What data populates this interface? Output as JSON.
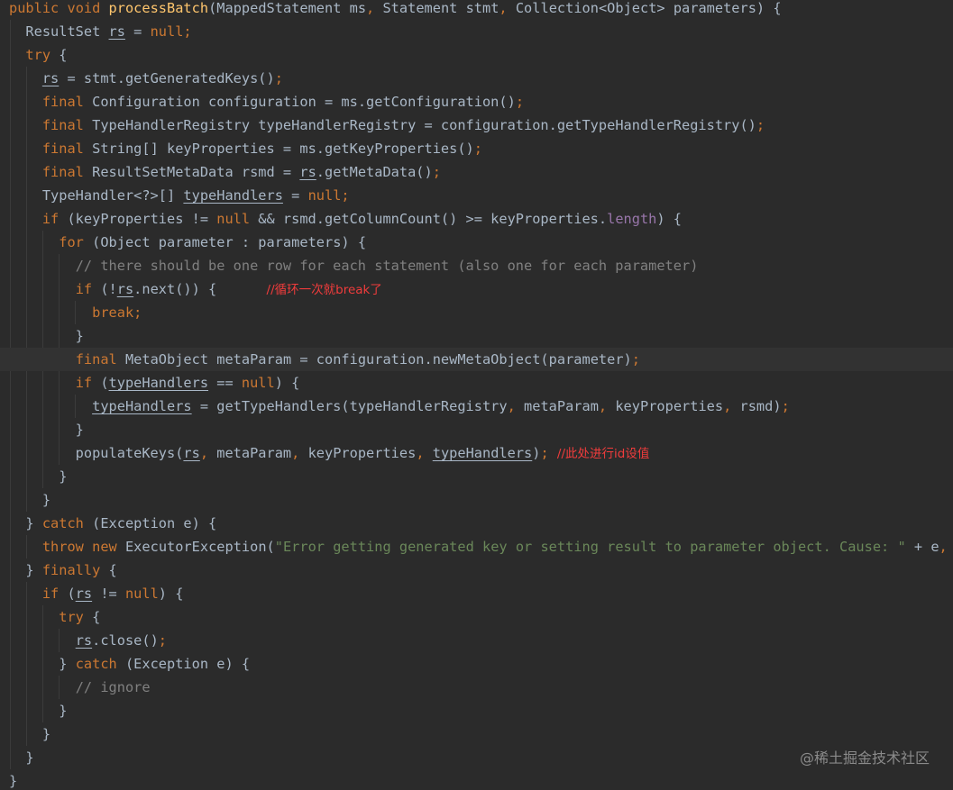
{
  "editor": {
    "theme": "darcula",
    "colors": {
      "background": "#2b2b2b",
      "current_line": "#323232",
      "default": "#a9b7c6",
      "keyword": "#cc7832",
      "method": "#ffc66d",
      "field": "#9876aa",
      "string": "#6a8759",
      "comment": "#808080",
      "annotation_note": "#f03c3c"
    },
    "lines": [
      "public void processBatch(MappedStatement ms, Statement stmt, Collection<Object> parameters) {",
      "  ResultSet rs = null;",
      "  try {",
      "    rs = stmt.getGeneratedKeys();",
      "    final Configuration configuration = ms.getConfiguration();",
      "    final TypeHandlerRegistry typeHandlerRegistry = configuration.getTypeHandlerRegistry();",
      "    final String[] keyProperties = ms.getKeyProperties();",
      "    final ResultSetMetaData rsmd = rs.getMetaData();",
      "    TypeHandler<?>[] typeHandlers = null;",
      "    if (keyProperties != null && rsmd.getColumnCount() >= keyProperties.length) {",
      "      for (Object parameter : parameters) {",
      "        // there should be one row for each statement (also one for each parameter)",
      "        if (!rs.next()) {      //循环一次就break了",
      "          break;",
      "        }",
      "        final MetaObject metaParam = configuration.newMetaObject(parameter);",
      "        if (typeHandlers == null) {",
      "          typeHandlers = getTypeHandlers(typeHandlerRegistry, metaParam, keyProperties, rsmd);",
      "        }",
      "        populateKeys(rs, metaParam, keyProperties, typeHandlers); //此处进行id设值",
      "      }",
      "    }",
      "  } catch (Exception e) {",
      "    throw new ExecutorException(\"Error getting generated key or setting result to parameter object. Cause: \" + e, e);",
      "  } finally {",
      "    if (rs != null) {",
      "      try {",
      "        rs.close();",
      "      } catch (Exception e) {",
      "        // ignore",
      "      }",
      "    }",
      "  }",
      "}"
    ],
    "current_line_index": 15,
    "annotations": [
      {
        "line_index": 12,
        "text": "//循环一次就break了"
      },
      {
        "line_index": 19,
        "text": "//此处进行id设值"
      }
    ]
  },
  "watermark": "@稀土掘金技术社区"
}
